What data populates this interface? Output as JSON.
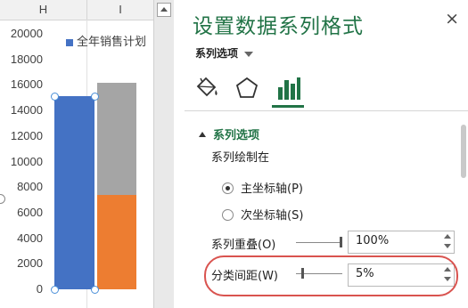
{
  "sheet": {
    "columns": [
      "H",
      "I"
    ],
    "chart": {
      "legend": "全年销售计划",
      "y_ticks": [
        "20000",
        "18000",
        "16000",
        "14000",
        "12000",
        "10000",
        "8000",
        "6000",
        "4000",
        "2000",
        "0"
      ],
      "colors": {
        "series1": "#4472c4",
        "series2_top": "#a5a5a5",
        "series2_bottom": "#ed7d31"
      }
    }
  },
  "chart_data": {
    "type": "bar",
    "title": "",
    "xlabel": "",
    "ylabel": "",
    "ylim": [
      0,
      20000
    ],
    "legend_placement": "top",
    "series": [
      {
        "name": "全年销售计划",
        "values": [
          15100
        ],
        "color": "#4472c4"
      },
      {
        "values": [
          7400
        ],
        "color": "#ed7d31"
      },
      {
        "values": [
          8800
        ],
        "color": "#a5a5a5"
      }
    ]
  },
  "pane": {
    "title": "设置数据系列格式",
    "close": "×",
    "dropdown": "系列选项",
    "section": "系列选项",
    "plot_on": "系列绘制在",
    "primary_axis": "主坐标轴(P)",
    "secondary_axis": "次坐标轴(S)",
    "overlap_label": "系列重叠(O)",
    "overlap_value": "100%",
    "gap_label": "分类间距(W)",
    "gap_value": "5%",
    "accent": "#217346",
    "highlight": "#d9534f"
  }
}
